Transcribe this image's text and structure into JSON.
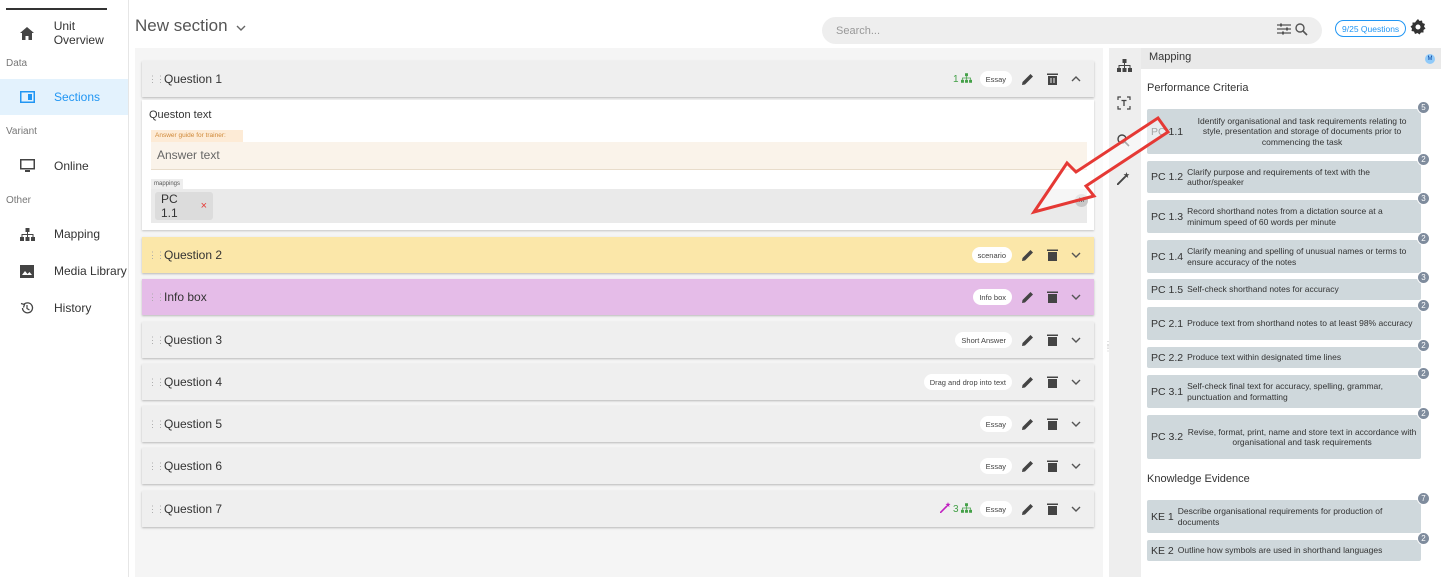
{
  "nav": {
    "items": [
      {
        "label": "Unit Overview",
        "icon": "home-icon"
      },
      {
        "label": "Sections",
        "icon": "sections-icon",
        "active": true
      },
      {
        "label": "Online",
        "icon": "monitor-icon"
      },
      {
        "label": "Mapping",
        "icon": "mapping-icon"
      },
      {
        "label": "Media Library",
        "icon": "image-icon"
      },
      {
        "label": "History",
        "icon": "history-icon"
      }
    ],
    "groups": {
      "data": "Data",
      "variant": "Variant",
      "other": "Other"
    }
  },
  "header": {
    "title": "New section",
    "search_placeholder": "Search...",
    "question_count": "9/25 Questions"
  },
  "expanded_question": {
    "text": "Queston text",
    "answer_guide_label": "Answer guide for trainer:",
    "answer_text": "Answer text",
    "mappings_label": "mappings",
    "chip": "PC 1.1",
    "chip_remove": "×",
    "badge": "M"
  },
  "questions": [
    {
      "name": "Question  1",
      "map_count": "1",
      "type": "Essay",
      "expanded": true
    },
    {
      "name": "Question  2",
      "type": "scenario",
      "style": "scenario"
    },
    {
      "name": "Info box",
      "type": "Info box",
      "style": "info"
    },
    {
      "name": "Question  3",
      "type": "Short Answer"
    },
    {
      "name": "Question  4",
      "type": "Drag and drop into text"
    },
    {
      "name": "Question  5",
      "type": "Essay"
    },
    {
      "name": "Question  6",
      "type": "Essay"
    },
    {
      "name": "Question  7",
      "map_count": "3",
      "type": "Essay",
      "wand": true
    }
  ],
  "panel": {
    "title": "Mapping",
    "tag": "M",
    "performance_title": "Performance Criteria",
    "performance": [
      {
        "code": "PC 1.1",
        "desc": "Identify organisational and task requirements relating to style, presentation and storage of documents prior to commencing the task",
        "count": "5"
      },
      {
        "code": "PC 1.2",
        "desc": "Clarify purpose and requirements of text with the author/speaker",
        "count": "2"
      },
      {
        "code": "PC 1.3",
        "desc": "Record shorthand notes from a dictation source at a minimum speed of 60 words per minute",
        "count": "3"
      },
      {
        "code": "PC 1.4",
        "desc": "Clarify meaning and spelling of unusual names or terms to ensure accuracy of the notes",
        "count": "2"
      },
      {
        "code": "PC 1.5",
        "desc": "Self-check shorthand notes for accuracy",
        "count": "3"
      },
      {
        "code": "PC 2.1",
        "desc": "Produce text from shorthand notes to at least 98% accuracy",
        "count": "2"
      },
      {
        "code": "PC 2.2",
        "desc": "Produce text within designated time lines",
        "count": "2"
      },
      {
        "code": "PC 3.1",
        "desc": "Self-check final text for accuracy, spelling, grammar, punctuation and formatting",
        "count": "2"
      },
      {
        "code": "PC 3.2",
        "desc": "Revise, format, print, name and store text in accordance with organisational and task requirements",
        "count": "2"
      }
    ],
    "knowledge_title": "Knowledge Evidence",
    "knowledge": [
      {
        "code": "KE 1",
        "desc": "Describe organisational requirements for production of documents",
        "count": "7"
      },
      {
        "code": "KE 2",
        "desc": "Outline how symbols are used in shorthand languages",
        "count": "2"
      }
    ]
  },
  "colors": {
    "accent": "#2196f3",
    "scenario": "#fbe7a9",
    "info": "#e5bce8",
    "arrow": "#e53935"
  }
}
